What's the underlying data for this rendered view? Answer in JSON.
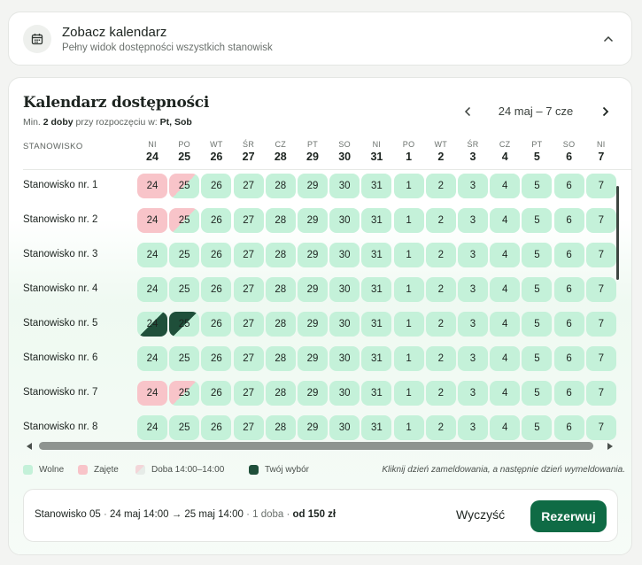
{
  "top_card": {
    "title": "Zobacz kalendarz",
    "subtitle": "Pełny widok dostępności wszystkich stanowisk",
    "icon": "calendar-icon",
    "toggle_icon": "chevron-up-icon"
  },
  "calendar": {
    "title": "Kalendarz dostępności",
    "sub_prefix": "Min.",
    "sub_min": "2 doby",
    "sub_mid": "przy rozpoczęciu w:",
    "sub_days": "Pt, Sob",
    "range": "24 maj – 7 cze",
    "column_header": "STANOWISKO",
    "days": [
      {
        "name": "NI",
        "num": "24"
      },
      {
        "name": "PO",
        "num": "25"
      },
      {
        "name": "WT",
        "num": "26"
      },
      {
        "name": "ŚR",
        "num": "27"
      },
      {
        "name": "CZ",
        "num": "28"
      },
      {
        "name": "PT",
        "num": "29"
      },
      {
        "name": "SO",
        "num": "30"
      },
      {
        "name": "NI",
        "num": "31"
      },
      {
        "name": "PO",
        "num": "1"
      },
      {
        "name": "WT",
        "num": "2"
      },
      {
        "name": "ŚR",
        "num": "3"
      },
      {
        "name": "CZ",
        "num": "4"
      },
      {
        "name": "PT",
        "num": "5"
      },
      {
        "name": "SO",
        "num": "6"
      },
      {
        "name": "NI",
        "num": "7"
      }
    ],
    "rows": [
      {
        "label": "Stanowisko nr. 1",
        "states": [
          "busy",
          "half",
          "free",
          "free",
          "free",
          "free",
          "free",
          "free",
          "free",
          "free",
          "free",
          "free",
          "free",
          "free",
          "free"
        ]
      },
      {
        "label": "Stanowisko nr. 2",
        "states": [
          "busy",
          "half",
          "free",
          "free",
          "free",
          "free",
          "free",
          "free",
          "free",
          "free",
          "free",
          "free",
          "free",
          "free",
          "free"
        ]
      },
      {
        "label": "Stanowisko nr. 3",
        "states": [
          "free",
          "free",
          "free",
          "free",
          "free",
          "free",
          "free",
          "free",
          "free",
          "free",
          "free",
          "free",
          "free",
          "free",
          "free"
        ]
      },
      {
        "label": "Stanowisko nr. 4",
        "states": [
          "free",
          "free",
          "free",
          "free",
          "free",
          "free",
          "free",
          "free",
          "free",
          "free",
          "free",
          "free",
          "free",
          "free",
          "free"
        ]
      },
      {
        "label": "Stanowisko nr. 5",
        "states": [
          "sel-a",
          "sel-b",
          "free",
          "free",
          "free",
          "free",
          "free",
          "free",
          "free",
          "free",
          "free",
          "free",
          "free",
          "free",
          "free"
        ]
      },
      {
        "label": "Stanowisko nr. 6",
        "states": [
          "free",
          "free",
          "free",
          "free",
          "free",
          "free",
          "free",
          "free",
          "free",
          "free",
          "free",
          "free",
          "free",
          "free",
          "free"
        ]
      },
      {
        "label": "Stanowisko nr. 7",
        "states": [
          "busy",
          "half",
          "free",
          "free",
          "free",
          "free",
          "free",
          "free",
          "free",
          "free",
          "free",
          "free",
          "free",
          "free",
          "free"
        ]
      },
      {
        "label": "Stanowisko nr. 8",
        "states": [
          "free",
          "free",
          "free",
          "free",
          "free",
          "free",
          "free",
          "free",
          "free",
          "free",
          "free",
          "free",
          "free",
          "free",
          "free"
        ]
      }
    ]
  },
  "legend": {
    "free": "Wolne",
    "busy": "Zajęte",
    "half": "Doba 14:00–14:00",
    "mine": "Twój wybór",
    "hint": "Kliknij dzień zameldowania, a następnie dzień wymeldowania."
  },
  "summary": {
    "station": "Stanowisko 05",
    "sep1": " · ",
    "dates": "24 maj 14:00 → 25 maj 14:00",
    "duration": " · 1 doba · ",
    "price": "od 150 zł",
    "clear_label": "Wyczyść",
    "book_label": "Rezerwuj"
  },
  "colors": {
    "free": "#c4f1d9",
    "busy": "#f8c4c9",
    "selected": "#1f4f3a",
    "primary": "#0f6b45"
  }
}
